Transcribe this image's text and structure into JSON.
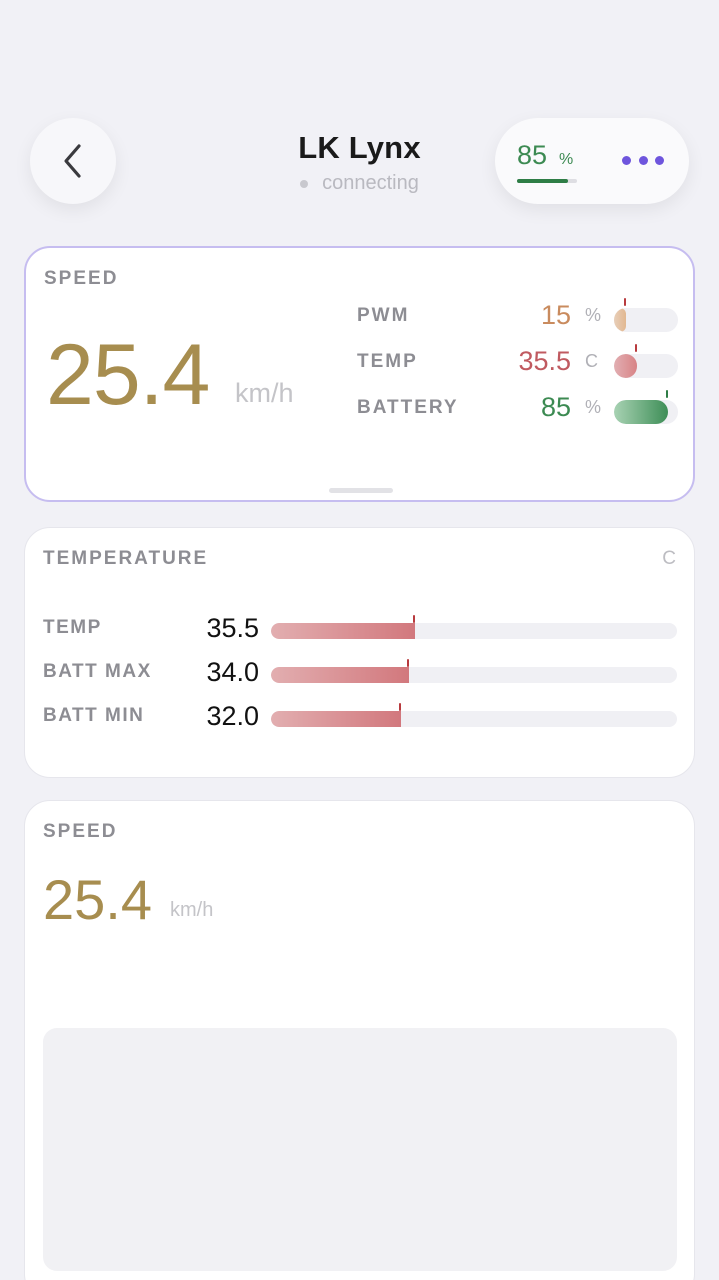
{
  "header": {
    "title": "LK Lynx",
    "status": "connecting",
    "battery": {
      "value": "85",
      "unit": "%",
      "level": 0.85
    }
  },
  "speed_card": {
    "label": "SPEED",
    "value": "25.4",
    "unit": "km/h",
    "metrics": [
      {
        "label": "PWM",
        "value": "15",
        "unit": "%",
        "level": 0.15,
        "color": "#c98b5e",
        "fill": "#e2b891"
      },
      {
        "label": "TEMP",
        "value": "35.5",
        "unit": "C",
        "level": 0.355,
        "color": "#c05a60",
        "fill": "#d88386"
      },
      {
        "label": "BATTERY",
        "value": "85",
        "unit": "%",
        "level": 0.85,
        "color": "#3c8a52",
        "fill": "#3e8e57"
      }
    ]
  },
  "temperature_card": {
    "label": "TEMPERATURE",
    "unit": "C",
    "rows": [
      {
        "label": "TEMP",
        "value": "35.5",
        "level": 0.355
      },
      {
        "label": "BATT MAX",
        "value": "34.0",
        "level": 0.34
      },
      {
        "label": "BATT MIN",
        "value": "32.0",
        "level": 0.32
      }
    ]
  },
  "speed_card_2": {
    "label": "SPEED",
    "value": "25.4",
    "unit": "km/h"
  },
  "colors": {
    "speed": "#a78d4f",
    "accent": "#6e55dd",
    "battery": "#3c8a52",
    "temp": "#c05a60"
  }
}
